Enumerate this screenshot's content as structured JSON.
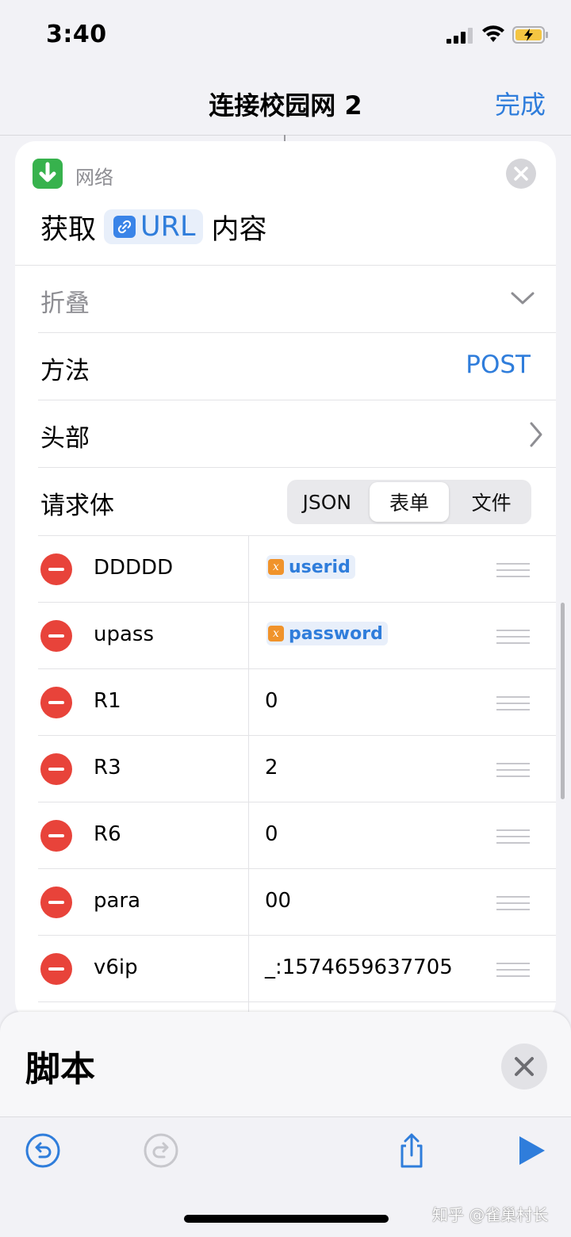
{
  "status_bar": {
    "time": "3:40"
  },
  "nav": {
    "title": "连接校园网 2",
    "done_label": "完成"
  },
  "action": {
    "category": "网络",
    "verb": "获取",
    "param_token": "URL",
    "suffix": "内容",
    "collapse_label": "折叠",
    "method_label": "方法",
    "method_value": "POST",
    "headers_label": "头部",
    "body_label": "请求体",
    "body_types": [
      "JSON",
      "表单",
      "文件"
    ],
    "body_selected": "表单",
    "fields": [
      {
        "key": "DDDDD",
        "value": "userid",
        "value_is_variable": true
      },
      {
        "key": "upass",
        "value": "password",
        "value_is_variable": true
      },
      {
        "key": "R1",
        "value": "0",
        "value_is_variable": false
      },
      {
        "key": "R3",
        "value": "2",
        "value_is_variable": false
      },
      {
        "key": "R6",
        "value": "0",
        "value_is_variable": false
      },
      {
        "key": "para",
        "value": "00",
        "value_is_variable": false
      },
      {
        "key": "v6ip",
        "value": "_:1574659637705",
        "value_is_variable": false
      }
    ],
    "variable_badge": "x"
  },
  "sheet": {
    "title": "脚本"
  },
  "watermark": "知乎 @雀巢村长",
  "icons": {
    "app_icon": "download-arrow-icon",
    "link_icon": "link-icon",
    "toolbar": [
      "undo-icon",
      "redo-icon",
      "share-icon",
      "play-icon"
    ]
  },
  "colors": {
    "accent": "#2f7ddb",
    "delete": "#e8433a",
    "network_green": "#37b24d",
    "variable_orange": "#f0932b"
  }
}
